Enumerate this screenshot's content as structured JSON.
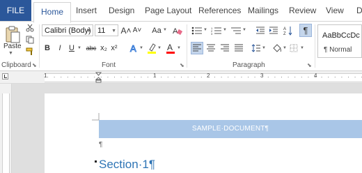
{
  "tabs": {
    "file": "FILE",
    "home": "Home",
    "insert": "Insert",
    "design": "Design",
    "page_layout": "Page Layout",
    "references": "References",
    "mailings": "Mailings",
    "review": "Review",
    "view": "View",
    "overflow": "D"
  },
  "clipboard": {
    "paste_label": "Paste",
    "group_label": "Clipboard"
  },
  "font": {
    "font_name": "Calibri (Body)",
    "font_size": "11",
    "grow_glyph": "A˄",
    "shrink_glyph": "A˅",
    "case_glyph": "Aa",
    "bold": "B",
    "italic": "I",
    "underline": "U",
    "strikethrough": "abc",
    "subscript": "x₂",
    "superscript": "x²",
    "group_label": "Font",
    "highlight_color": "#ffff00",
    "font_color": "#ff0000"
  },
  "paragraph": {
    "group_label": "Paragraph",
    "pilcrow": "¶"
  },
  "styles": {
    "preview": "AaBbCcDc",
    "name": "¶ Normal"
  },
  "ruler": {
    "numbers": [
      "1",
      "1",
      "2",
      "3",
      "4"
    ]
  },
  "document": {
    "banner_text": "SAMPLE·DOCUMENT¶",
    "empty_para": "¶",
    "section_heading": "Section·1¶"
  },
  "colors": {
    "accent": "#2b579a",
    "heading": "#2e74b5",
    "banner": "#a9c6e7"
  }
}
